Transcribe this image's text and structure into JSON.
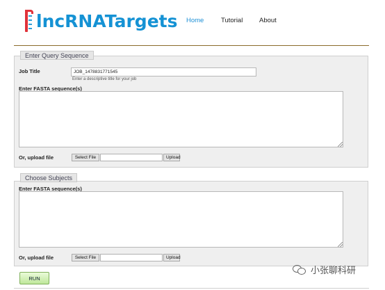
{
  "app": {
    "logo_text": "lncRNATargets"
  },
  "nav": {
    "items": [
      {
        "label": "Home",
        "active": true
      },
      {
        "label": "Tutorial",
        "active": false
      },
      {
        "label": "About",
        "active": false
      }
    ]
  },
  "query": {
    "legend": "Enter Query Sequence",
    "job_title_label": "Job Title",
    "job_title_value": "JOB_1478831771545",
    "job_title_hint": "Enter a descriptive title for your job",
    "fasta_label": "Enter FASTA sequence(s)",
    "fasta_value": "",
    "upload_label": "Or, upload file",
    "select_file_label": "Select File",
    "upload_button_label": "Upload"
  },
  "subjects": {
    "legend": "Choose Subjects",
    "fasta_label": "Enter FASTA sequence(s)",
    "fasta_value": "",
    "upload_label": "Or, upload file",
    "select_file_label": "Select File",
    "upload_button_label": "Upload"
  },
  "run_button_label": "RUN",
  "watermark_text": "小张聊科研",
  "colors": {
    "logo_blue": "#1592d4",
    "logo_red": "#e0323a",
    "nav_active": "#1e90d6",
    "panel_bg": "#efefef",
    "run_green": "#bfe79b"
  }
}
